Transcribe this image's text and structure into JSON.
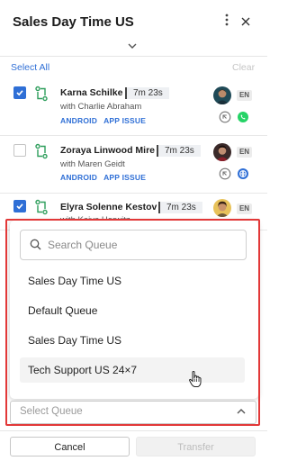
{
  "header": {
    "title": "Sales Day Time US",
    "menu_icon": "kebab-menu-icon",
    "close_icon": "close-icon",
    "expand_icon": "chevron-down-icon"
  },
  "toolbar": {
    "select_all": "Select All",
    "clear": "Clear"
  },
  "contacts": [
    {
      "name": "Karna Schilke",
      "duration": "7m 23s",
      "with": "with Charlie Abraham",
      "tags": [
        "ANDROID",
        "APP ISSUE"
      ],
      "lang": "EN",
      "selected": true,
      "channel": "whatsapp"
    },
    {
      "name": "Zoraya Linwood Mire",
      "duration": "7m 23s",
      "with": "with Maren Geidt",
      "tags": [
        "ANDROID",
        "APP ISSUE"
      ],
      "lang": "EN",
      "selected": false,
      "channel": "web"
    },
    {
      "name": "Elyra Solenne Kestov",
      "duration": "7m 23s",
      "with": "with Kaiva Herwitz",
      "tags": [],
      "lang": "EN",
      "selected": true,
      "channel": ""
    }
  ],
  "dropdown": {
    "search_placeholder": "Search Queue",
    "options": [
      "Sales Day Time US",
      "Default Queue",
      "Sales Day Time US",
      "Tech Support US 24×7"
    ],
    "hovered_index": 3
  },
  "queue_select": {
    "placeholder": "Select Queue"
  },
  "footer": {
    "cancel_label": "Cancel",
    "transfer_label": "Transfer"
  },
  "colors": {
    "accent": "#2f6fd6",
    "highlight": "#e23838",
    "whatsapp": "#25d366"
  }
}
